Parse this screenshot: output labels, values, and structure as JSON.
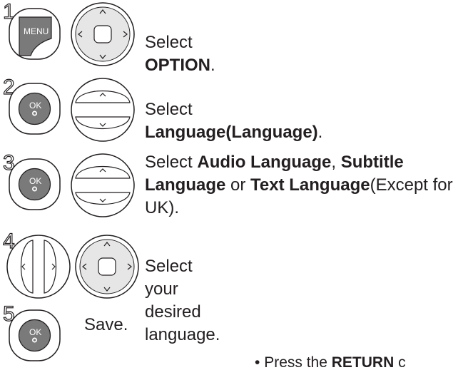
{
  "steps": [
    {
      "number": "1",
      "button": "MENU",
      "parts": [
        {
          "t": "Select ",
          "b": false
        },
        {
          "t": "OPTION",
          "b": true
        },
        {
          "t": ".",
          "b": false
        }
      ]
    },
    {
      "number": "2",
      "button": "OK",
      "parts": [
        {
          "t": "Select ",
          "b": false
        },
        {
          "t": "Language(Language)",
          "b": true
        },
        {
          "t": ".",
          "b": false
        }
      ]
    },
    {
      "number": "3",
      "button": "OK",
      "parts": [
        {
          "t": "Select ",
          "b": false
        },
        {
          "t": "Audio Language",
          "b": true
        },
        {
          "t": ", ",
          "b": false
        },
        {
          "t": "Subtitle Language",
          "b": true
        },
        {
          "t": " or ",
          "b": false
        },
        {
          "t": "Text Language",
          "b": true
        },
        {
          "t": "(Except for UK).",
          "b": false
        }
      ]
    },
    {
      "number": "4",
      "parts": [
        {
          "t": "Select your desired language.",
          "b": false
        }
      ]
    },
    {
      "number": "5",
      "button": "OK",
      "parts": [
        {
          "t": "Save.",
          "b": false
        }
      ]
    }
  ],
  "note": {
    "bullet": "•",
    "prefix": "Press the ",
    "bold": "RETURN",
    "suffix": " c"
  },
  "colors": {
    "button_fill": "#7a7a7a",
    "ring": "#231f20",
    "nav_fill": "#e6e6e6"
  }
}
